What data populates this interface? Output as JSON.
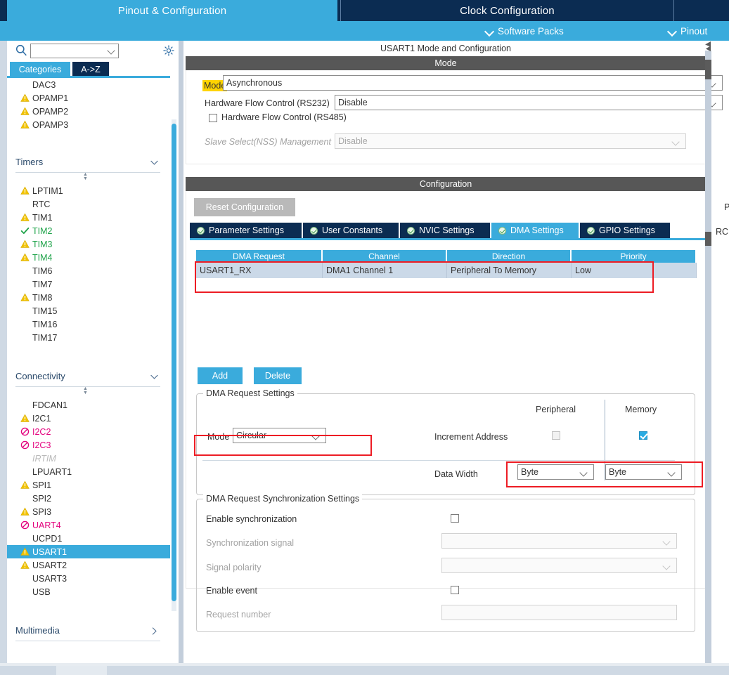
{
  "top_tabs": [
    {
      "label": "Pinout & Configuration",
      "active": true
    },
    {
      "label": "Clock Configuration",
      "active": false
    },
    {
      "label": "",
      "active": false
    }
  ],
  "subbar": {
    "software_packs": "Software Packs",
    "pinout": "Pinout"
  },
  "sidebar": {
    "search_placeholder": "",
    "search_value": "",
    "tabs": [
      {
        "label": "Categories",
        "active": true
      },
      {
        "label": "A->Z",
        "active": false
      }
    ],
    "items": [
      {
        "label": "DAC3",
        "icon": "none",
        "color": "normal",
        "selected": false
      },
      {
        "label": "OPAMP1",
        "icon": "warning",
        "color": "normal",
        "selected": false
      },
      {
        "label": "OPAMP2",
        "icon": "warning",
        "color": "normal",
        "selected": false
      },
      {
        "label": "OPAMP3",
        "icon": "warning",
        "color": "normal",
        "selected": false
      }
    ],
    "groups": [
      {
        "title": "Timers",
        "chevron": "chevron-down-icon",
        "items": [
          {
            "label": "LPTIM1",
            "icon": "warning",
            "color": "normal",
            "selected": false
          },
          {
            "label": "RTC",
            "icon": "none",
            "color": "normal",
            "selected": false
          },
          {
            "label": "TIM1",
            "icon": "warning",
            "color": "normal",
            "selected": false
          },
          {
            "label": "TIM2",
            "icon": "check",
            "color": "green",
            "selected": false
          },
          {
            "label": "TIM3",
            "icon": "warning",
            "color": "green",
            "selected": false
          },
          {
            "label": "TIM4",
            "icon": "warning",
            "color": "green",
            "selected": false
          },
          {
            "label": "TIM6",
            "icon": "none",
            "color": "normal",
            "selected": false
          },
          {
            "label": "TIM7",
            "icon": "none",
            "color": "normal",
            "selected": false
          },
          {
            "label": "TIM8",
            "icon": "warning",
            "color": "normal",
            "selected": false
          },
          {
            "label": "TIM15",
            "icon": "none",
            "color": "normal",
            "selected": false
          },
          {
            "label": "TIM16",
            "icon": "none",
            "color": "normal",
            "selected": false
          },
          {
            "label": "TIM17",
            "icon": "none",
            "color": "normal",
            "selected": false
          }
        ]
      },
      {
        "title": "Connectivity",
        "chevron": "chevron-down-icon",
        "items": [
          {
            "label": "FDCAN1",
            "icon": "none",
            "color": "normal",
            "selected": false
          },
          {
            "label": "I2C1",
            "icon": "warning",
            "color": "normal",
            "selected": false
          },
          {
            "label": "I2C2",
            "icon": "forbidden",
            "color": "pink",
            "selected": false
          },
          {
            "label": "I2C3",
            "icon": "forbidden",
            "color": "pink",
            "selected": false
          },
          {
            "label": "IRTIM",
            "icon": "none",
            "color": "gray-italic",
            "selected": false
          },
          {
            "label": "LPUART1",
            "icon": "none",
            "color": "normal",
            "selected": false
          },
          {
            "label": "SPI1",
            "icon": "warning",
            "color": "normal",
            "selected": false
          },
          {
            "label": "SPI2",
            "icon": "none",
            "color": "normal",
            "selected": false
          },
          {
            "label": "SPI3",
            "icon": "warning",
            "color": "normal",
            "selected": false
          },
          {
            "label": "UART4",
            "icon": "forbidden",
            "color": "pink",
            "selected": false
          },
          {
            "label": "UCPD1",
            "icon": "none",
            "color": "normal",
            "selected": false
          },
          {
            "label": "USART1",
            "icon": "warning",
            "color": "normal",
            "selected": true
          },
          {
            "label": "USART2",
            "icon": "warning",
            "color": "normal",
            "selected": false
          },
          {
            "label": "USART3",
            "icon": "none",
            "color": "normal",
            "selected": false
          },
          {
            "label": "USB",
            "icon": "none",
            "color": "normal",
            "selected": false
          }
        ]
      },
      {
        "title": "Multimedia",
        "chevron": "chevron-right-icon",
        "items": []
      }
    ]
  },
  "main": {
    "title": "USART1 Mode and Configuration",
    "mode_section": {
      "header": "Mode",
      "mode_label": "Mode",
      "mode_value": "Asynchronous",
      "hw_flow_rs232_label": "Hardware Flow Control (RS232)",
      "hw_flow_rs232_value": "Disable",
      "hw_flow_rs485_label": "Hardware Flow Control (RS485)",
      "hw_flow_rs485_checked": false,
      "nss_label": "Slave Select(NSS) Management",
      "nss_value": "Disable"
    },
    "configuration": {
      "header": "Configuration",
      "reset_button": "Reset Configuration",
      "tabs": [
        {
          "label": "Parameter Settings",
          "active": false
        },
        {
          "label": "User Constants",
          "active": false
        },
        {
          "label": "NVIC Settings",
          "active": false
        },
        {
          "label": "DMA Settings",
          "active": true
        },
        {
          "label": "GPIO Settings",
          "active": false
        }
      ],
      "dma_table": {
        "columns": [
          "DMA Request",
          "Channel",
          "Direction",
          "Priority"
        ],
        "rows": [
          [
            "USART1_RX",
            "DMA1 Channel 1",
            "Peripheral To Memory",
            "Low"
          ]
        ]
      },
      "add_button": "Add",
      "delete_button": "Delete",
      "request_settings": {
        "legend": "DMA Request Settings",
        "col_peripheral": "Peripheral",
        "col_memory": "Memory",
        "mode_label": "Mode",
        "mode_value": "Circular",
        "increment_label": "Increment Address",
        "increment_peripheral_checked": false,
        "increment_memory_checked": true,
        "data_width_label": "Data Width",
        "data_width_peripheral": "Byte",
        "data_width_memory": "Byte"
      },
      "sync_settings": {
        "legend": "DMA Request Synchronization Settings",
        "enable_sync_label": "Enable synchronization",
        "enable_sync_checked": false,
        "sync_signal_label": "Synchronization signal",
        "sync_signal_value": "",
        "signal_polarity_label": "Signal polarity",
        "signal_polarity_value": "",
        "enable_event_label": "Enable event",
        "enable_event_checked": false,
        "request_number_label": "Request number",
        "request_number_value": ""
      }
    }
  },
  "right_cut_text": {
    "line1": "P",
    "line2": "RC"
  },
  "colors": {
    "accent_blue": "#3aabdc",
    "dark_navy": "#0b2c52",
    "highlight_red": "#ed1c24",
    "warning_yellow": "#f2c200",
    "ok_green": "#1fa34a",
    "forbidden_pink": "#e3007d",
    "mode_highlight": "#ffd400"
  }
}
